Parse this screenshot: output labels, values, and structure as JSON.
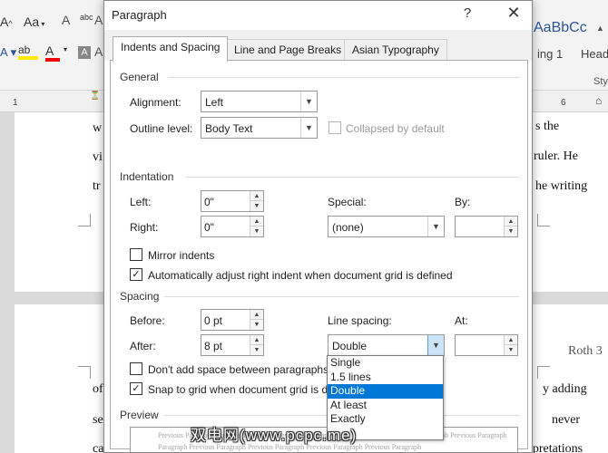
{
  "background": {
    "ribbon": {
      "font_size_label": "Aa",
      "change_case_label": "Aa",
      "abc_label": "abc",
      "style_preview": "AaBbCc",
      "heading1_label": "ing 1",
      "heading2_label": "Head",
      "styles_group_label": "Sty"
    },
    "ruler": {
      "left_number": "1",
      "right_number": "6"
    },
    "document": {
      "page1_left_lines": [
        "w",
        "vi",
        "tr"
      ],
      "page1_right_lines": [
        "s the",
        "ruler. He",
        "he writing"
      ],
      "header_text": "Roth 3",
      "page2_left_lines": [
        "of",
        "se",
        "ca"
      ],
      "page2_right_lines": [
        "y adding",
        "never",
        "erpretations"
      ]
    }
  },
  "dialog": {
    "title": "Paragraph",
    "help_label": "?",
    "close_label": "✕",
    "tabs": [
      {
        "label": "Indents and Spacing",
        "active": true
      },
      {
        "label": "Line and Page Breaks",
        "active": false
      },
      {
        "label": "Asian Typography",
        "active": false
      }
    ],
    "general": {
      "heading": "General",
      "alignment_label": "Alignment:",
      "alignment_value": "Left",
      "outline_label": "Outline level:",
      "outline_value": "Body Text",
      "collapsed_label": "Collapsed by default"
    },
    "indentation": {
      "heading": "Indentation",
      "left_label": "Left:",
      "left_value": "0\"",
      "right_label": "Right:",
      "right_value": "0\"",
      "special_label": "Special:",
      "special_value": "(none)",
      "by_label": "By:",
      "by_value": "",
      "mirror_label": "Mirror indents",
      "auto_adjust_label": "Automatically adjust right indent when document grid is defined"
    },
    "spacing": {
      "heading": "Spacing",
      "before_label": "Before:",
      "before_value": "0 pt",
      "after_label": "After:",
      "after_value": "8 pt",
      "line_spacing_label": "Line spacing:",
      "line_spacing_value": "Double",
      "at_label": "At:",
      "at_value": "",
      "dont_add_label": "Don't add space between paragraphs o",
      "snap_label": "Snap to grid when document grid is de"
    },
    "line_spacing_options": [
      "Single",
      "1.5 lines",
      "Double",
      "At least",
      "Exactly"
    ],
    "line_spacing_selected_index": 2,
    "preview": {
      "heading": "Preview",
      "line1": "Previous Paragraph Previous Paragraph Previous Paragraph Previous Paragraph Previous Paragraph Previous Paragraph",
      "line2": "Paragraph Previous Paragraph Previous Paragraph Previous Paragraph Previous Paragraph"
    }
  },
  "watermark": "双电网(www.pcpc.me)"
}
